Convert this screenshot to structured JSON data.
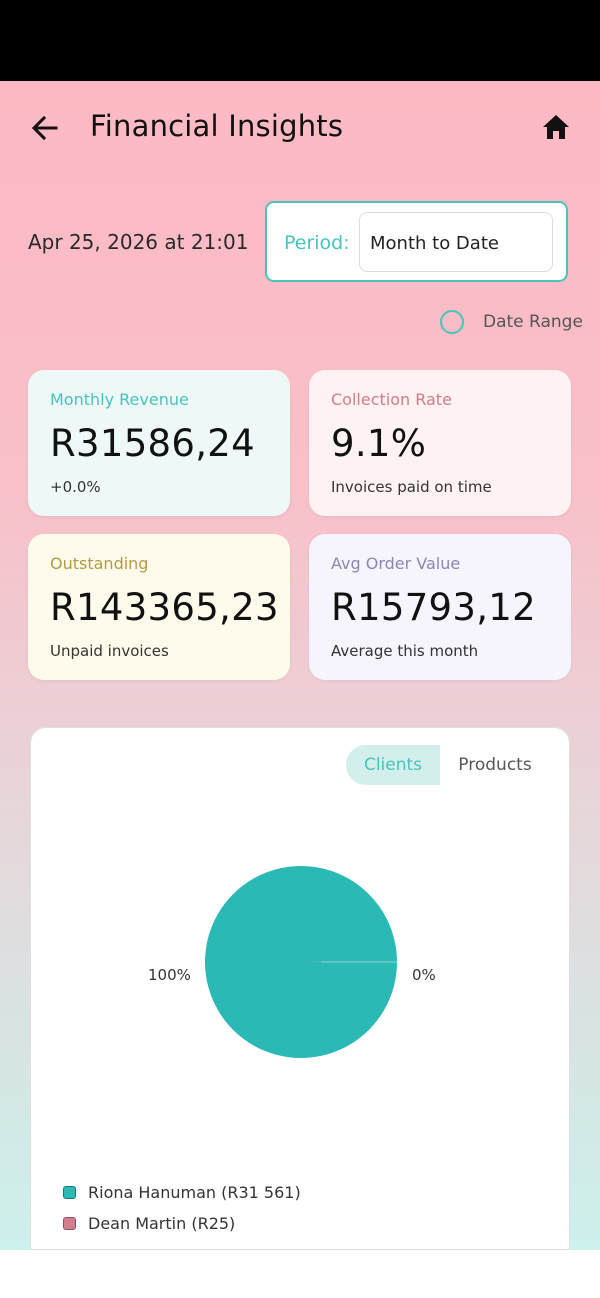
{
  "header": {
    "title": "Financial Insights",
    "back_icon": "arrow-left-icon",
    "home_icon": "home-icon"
  },
  "filters": {
    "datetime": "Apr 25, 2026 at 21:01",
    "period_label": "Period:",
    "period_value": "Month to Date",
    "date_range_label": "Date Range"
  },
  "cards": [
    {
      "title": "Monthly Revenue",
      "value": "R31586,24",
      "sub": "+0.0%"
    },
    {
      "title": "Collection Rate",
      "value": "9.1%",
      "sub": "Invoices paid on time"
    },
    {
      "title": "Outstanding",
      "value": "R143365,23",
      "sub": "Unpaid invoices"
    },
    {
      "title": "Avg Order Value",
      "value": "R15793,12",
      "sub": "Average this month"
    }
  ],
  "chart": {
    "tabs": {
      "clients": "Clients",
      "products": "Products",
      "active": "Clients"
    }
  },
  "chart_data": {
    "type": "pie",
    "labels": [
      "Riona Hanuman (R31 561)",
      "Dean Martin (R25)"
    ],
    "values": [
      31561,
      25
    ],
    "percent_labels": [
      "100%",
      "0%"
    ],
    "colors": [
      "#2bb9b6",
      "#d47d91"
    ],
    "legend_position": "bottom-left"
  },
  "colors": {
    "accent": "#49c3bc"
  }
}
